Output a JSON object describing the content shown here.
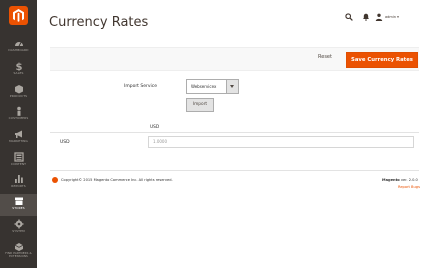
{
  "sidebar": {
    "items": [
      {
        "label": "DASHBOARD",
        "icon": "dashboard-icon"
      },
      {
        "label": "SALES",
        "icon": "dollar-icon"
      },
      {
        "label": "PRODUCTS",
        "icon": "cube-icon"
      },
      {
        "label": "CUSTOMERS",
        "icon": "person-icon"
      },
      {
        "label": "MARKETING",
        "icon": "megaphone-icon"
      },
      {
        "label": "CONTENT",
        "icon": "layout-icon"
      },
      {
        "label": "REPORTS",
        "icon": "bar-chart-icon"
      },
      {
        "label": "STORES",
        "icon": "store-icon",
        "active": true
      },
      {
        "label": "SYSTEM",
        "icon": "gear-icon"
      },
      {
        "label": "FIND PARTNERS & EXTENSIONS",
        "icon": "extensions-icon"
      }
    ]
  },
  "header": {
    "title": "Currency Rates",
    "user": "admin"
  },
  "actions": {
    "reset_label": "Reset",
    "save_label": "Save Currency Rates"
  },
  "import": {
    "label": "Import Service",
    "service": "Webservicex",
    "button_label": "Import"
  },
  "rates": {
    "column_header": "USD",
    "row_label": "USD",
    "row_value": "1.0000"
  },
  "footer": {
    "copyright": "Copyright© 2015 Magento Commerce Inc. All rights reserved.",
    "brand": "Magento",
    "version": "ver. 2.0.0",
    "report_bugs": "Report Bugs"
  },
  "colors": {
    "accent": "#eb5202",
    "sidebar": "#373330"
  }
}
